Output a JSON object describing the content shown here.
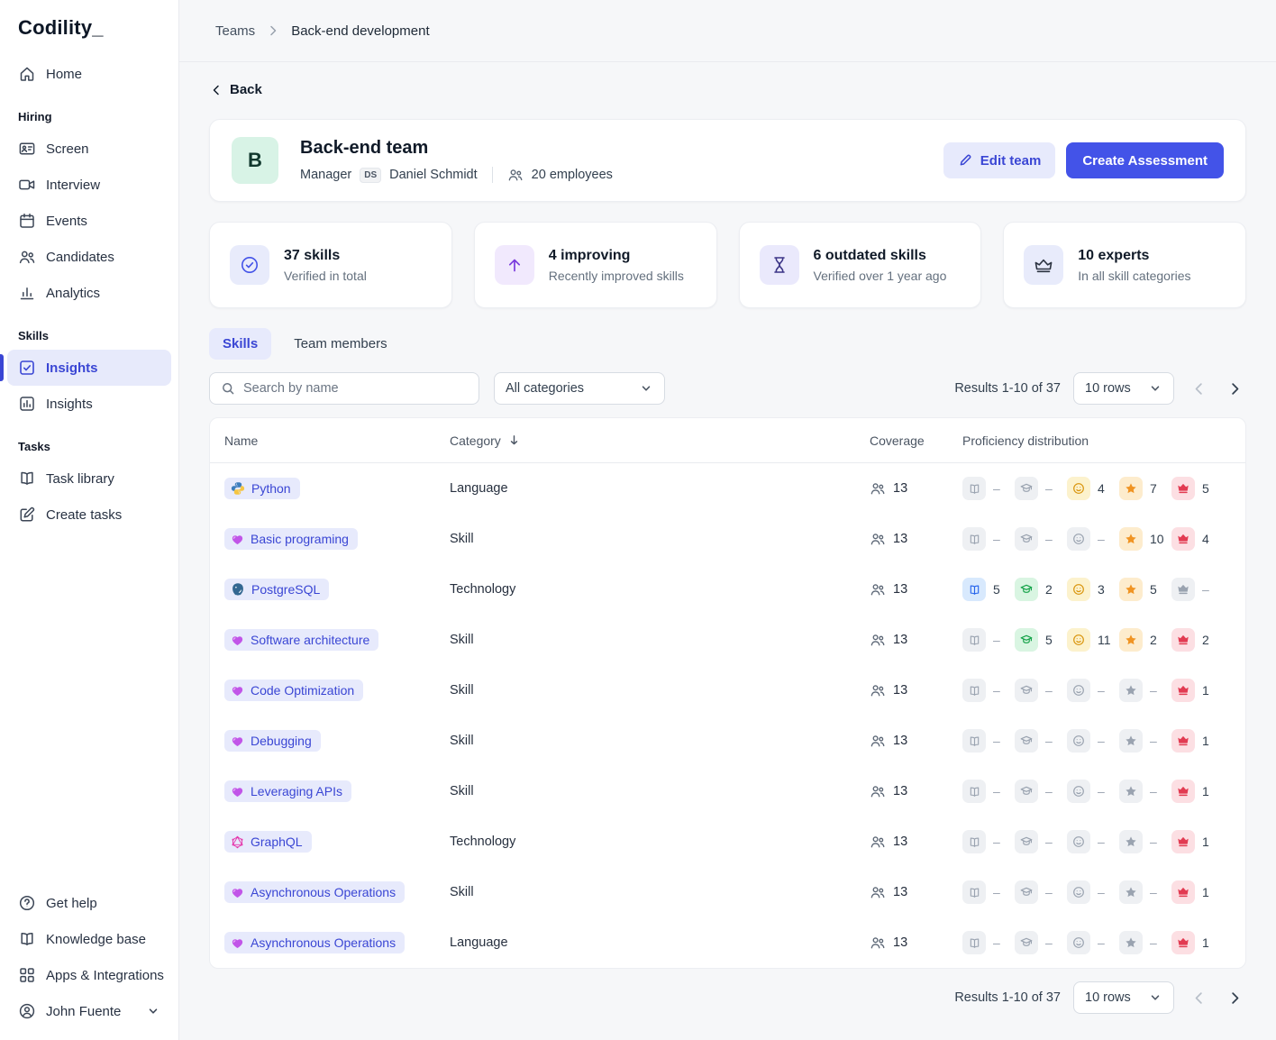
{
  "brand": {
    "logo": "Codility_"
  },
  "sidebar": {
    "sections": [
      {
        "header": null,
        "items": [
          {
            "label": "Home",
            "icon": "home-icon"
          }
        ]
      },
      {
        "header": "Hiring",
        "items": [
          {
            "label": "Screen",
            "icon": "screen-icon"
          },
          {
            "label": "Interview",
            "icon": "interview-icon"
          },
          {
            "label": "Events",
            "icon": "events-icon"
          },
          {
            "label": "Candidates",
            "icon": "candidates-icon"
          },
          {
            "label": "Analytics",
            "icon": "analytics-icon"
          }
        ]
      },
      {
        "header": "Skills",
        "items": [
          {
            "label": "Insights",
            "icon": "insights-check-icon",
            "active": true
          },
          {
            "label": "Insights",
            "icon": "insights-chart-icon"
          }
        ]
      },
      {
        "header": "Tasks",
        "items": [
          {
            "label": "Task library",
            "icon": "task-library-icon"
          },
          {
            "label": "Create tasks",
            "icon": "create-tasks-icon"
          }
        ]
      }
    ],
    "footer_items": [
      {
        "label": "Get help",
        "icon": "help-icon"
      },
      {
        "label": "Knowledge base",
        "icon": "knowledge-base-icon"
      },
      {
        "label": "Apps & Integrations",
        "icon": "apps-icon"
      }
    ],
    "user": {
      "name": "John Fuente",
      "icon": "user-icon"
    }
  },
  "breadcrumb": {
    "parent": "Teams",
    "current": "Back-end development"
  },
  "page": {
    "back_label": "Back",
    "team": {
      "avatar": "B",
      "name": "Back-end team",
      "manager_label": "Manager",
      "manager_initials": "DS",
      "manager_name": "Daniel Schmidt",
      "employees": "20 employees",
      "edit_button": "Edit team",
      "create_button": "Create Assessment"
    },
    "stats": [
      {
        "icon": "check-circle-icon",
        "icon_bg": "#e8ebfb",
        "icon_fg": "#4353e8",
        "value": "37 skills",
        "caption": "Verified in total"
      },
      {
        "icon": "arrow-up-icon",
        "icon_bg": "#f1e9fd",
        "icon_fg": "#7a3bdd",
        "value": "4 improving",
        "caption": "Recently improved skills"
      },
      {
        "icon": "hourglass-icon",
        "icon_bg": "#eae9fc",
        "icon_fg": "#3b3486",
        "value": "6 outdated skills",
        "caption": "Verified over 1 year ago"
      },
      {
        "icon": "crown-large-icon",
        "icon_bg": "#e8ebfb",
        "icon_fg": "#2b3240",
        "value": "10 experts",
        "caption": "In all skill categories"
      }
    ],
    "tabs": [
      {
        "label": "Skills",
        "active": true
      },
      {
        "label": "Team members",
        "active": false
      }
    ],
    "filters": {
      "search_placeholder": "Search by name",
      "category_select": "All categories"
    },
    "pagination": {
      "results": "Results 1-10 of 37",
      "rows_label": "10 rows"
    },
    "table": {
      "columns": [
        "Name",
        "Category",
        "Coverage",
        "Proficiency distribution"
      ],
      "levels": [
        {
          "icon": "book-icon",
          "bg": "#d8e9fd",
          "fg": "#2563eb"
        },
        {
          "icon": "graduation-icon",
          "bg": "#d9f5e2",
          "fg": "#16a34a"
        },
        {
          "icon": "face-icon",
          "bg": "#fcf2cd",
          "fg": "#d9940b"
        },
        {
          "icon": "star-icon",
          "bg": "#fdeccd",
          "fg": "#f09423"
        },
        {
          "icon": "crown-icon",
          "bg": "#fcdfe3",
          "fg": "#e23b52"
        }
      ],
      "inactive": {
        "bg": "#eef0f3",
        "fg": "#9aa3b0"
      },
      "rows": [
        {
          "name": "Python",
          "icon": "python-icon",
          "category": "Language",
          "coverage": "13",
          "distribution": [
            "-",
            "-",
            "4",
            "7",
            "5"
          ]
        },
        {
          "name": "Basic programing",
          "icon": "skill-icon",
          "category": "Skill",
          "coverage": "13",
          "distribution": [
            "-",
            "-",
            "-",
            "10",
            "4"
          ]
        },
        {
          "name": "PostgreSQL",
          "icon": "postgres-icon",
          "category": "Technology",
          "coverage": "13",
          "distribution": [
            "5",
            "2",
            "3",
            "5",
            "-"
          ]
        },
        {
          "name": "Software architecture",
          "icon": "skill-icon",
          "category": "Skill",
          "coverage": "13",
          "distribution": [
            "-",
            "5",
            "11",
            "2",
            "2"
          ]
        },
        {
          "name": "Code Optimization",
          "icon": "skill-icon",
          "category": "Skill",
          "coverage": "13",
          "distribution": [
            "-",
            "-",
            "-",
            "-",
            "1"
          ]
        },
        {
          "name": "Debugging",
          "icon": "skill-icon",
          "category": "Skill",
          "coverage": "13",
          "distribution": [
            "-",
            "-",
            "-",
            "-",
            "1"
          ]
        },
        {
          "name": "Leveraging APIs",
          "icon": "skill-icon",
          "category": "Skill",
          "coverage": "13",
          "distribution": [
            "-",
            "-",
            "-",
            "-",
            "1"
          ]
        },
        {
          "name": "GraphQL",
          "icon": "graphql-icon",
          "category": "Technology",
          "coverage": "13",
          "distribution": [
            "-",
            "-",
            "-",
            "-",
            "1"
          ]
        },
        {
          "name": "Asynchronous Operations",
          "icon": "skill-icon",
          "category": "Skill",
          "coverage": "13",
          "distribution": [
            "-",
            "-",
            "-",
            "-",
            "1"
          ]
        },
        {
          "name": "Asynchronous Operations",
          "icon": "skill-icon",
          "category": "Language",
          "coverage": "13",
          "distribution": [
            "-",
            "-",
            "-",
            "-",
            "1"
          ]
        }
      ]
    }
  },
  "theme": {
    "accent": "#4353e8",
    "pill_bg": "#e7eafc",
    "pill_text": "#3a46d4",
    "active_nav_bg": "#e7eafb",
    "avatar_bg": "#d8f3e6"
  }
}
